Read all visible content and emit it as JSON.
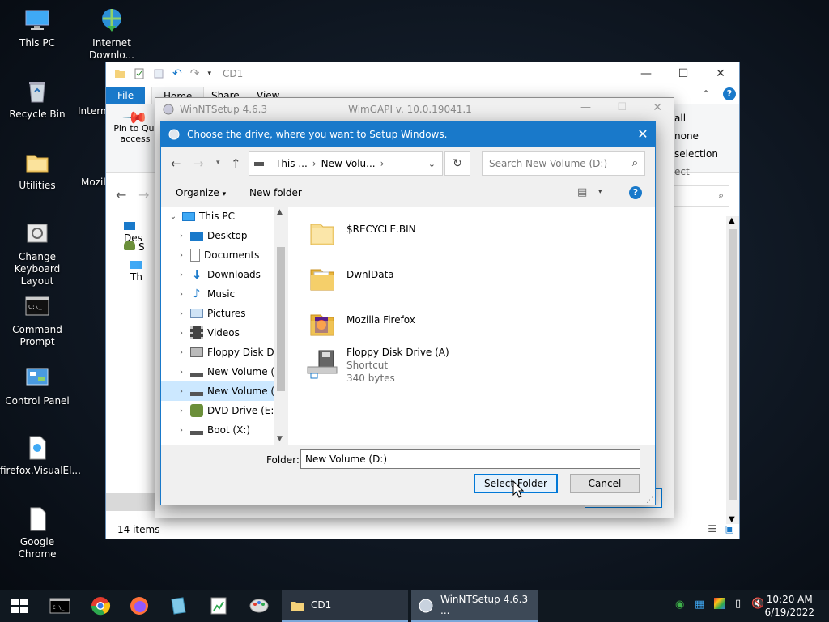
{
  "desktop": {
    "icons": [
      {
        "label": "This PC"
      },
      {
        "label": "Internet Downlo..."
      },
      {
        "label": "Recycle Bin"
      },
      {
        "label": "Interne"
      },
      {
        "label": "Utilities"
      },
      {
        "label": "Mozill"
      },
      {
        "label": "Change Keyboard Layout"
      },
      {
        "label": "Command Prompt"
      },
      {
        "label": "Control Panel"
      },
      {
        "label": "firefox.VisualEl..."
      },
      {
        "label": "Google Chrome"
      }
    ]
  },
  "explorer": {
    "title": "CD1",
    "tabs": [
      "File",
      "Home",
      "Share",
      "View"
    ],
    "pin_label": "Pin to Quick access",
    "pin_line1": "Pin to Qui",
    "pin_line2": "access",
    "ribbon_right": [
      "all",
      "none",
      "selection",
      "ect"
    ],
    "status": "14 items",
    "nav_partial": [
      "Des",
      "S",
      "Th"
    ]
  },
  "winntsetup": {
    "title": "WinNTSetup 4.6.3",
    "subtitle": "WimGAPI v. 10.0.19041.1"
  },
  "dialog": {
    "title": "Choose the drive, where you want to Setup Windows.",
    "breadcrumb": [
      "This ...",
      "New Volu..."
    ],
    "search_placeholder": "Search New Volume (D:)",
    "organize": "Organize",
    "new_folder": "New folder",
    "nav": [
      {
        "label": "This PC",
        "level": 0,
        "expanded": true
      },
      {
        "label": "Desktop",
        "level": 1
      },
      {
        "label": "Documents",
        "level": 1
      },
      {
        "label": "Downloads",
        "level": 1
      },
      {
        "label": "Music",
        "level": 1
      },
      {
        "label": "Pictures",
        "level": 1
      },
      {
        "label": "Videos",
        "level": 1
      },
      {
        "label": "Floppy Disk Dri",
        "level": 1
      },
      {
        "label": "New Volume (C",
        "level": 1
      },
      {
        "label": "New Volume (D",
        "level": 1,
        "selected": true
      },
      {
        "label": "DVD Drive (E:) I",
        "level": 1
      },
      {
        "label": "Boot (X:)",
        "level": 1
      }
    ],
    "files": [
      {
        "name": "$RECYCLE.BIN"
      },
      {
        "name": "DwnlData"
      },
      {
        "name": "Mozilla Firefox"
      },
      {
        "name": "Floppy Disk Drive (A)",
        "type": "Shortcut",
        "size": "340 bytes"
      }
    ],
    "folder_label": "Folder:",
    "folder_value": "New Volume (D:)",
    "select_button": "Select Folder",
    "cancel_button": "Cancel"
  },
  "taskbar": {
    "apps": [
      {
        "label": "CD1"
      },
      {
        "label": "WinNTSetup 4.6.3 ..."
      }
    ],
    "time": "10:20 AM",
    "date": "6/19/2022"
  },
  "colors": {
    "accent": "#1979ca",
    "selection": "#cce8ff",
    "folder": "#f5d27a"
  }
}
